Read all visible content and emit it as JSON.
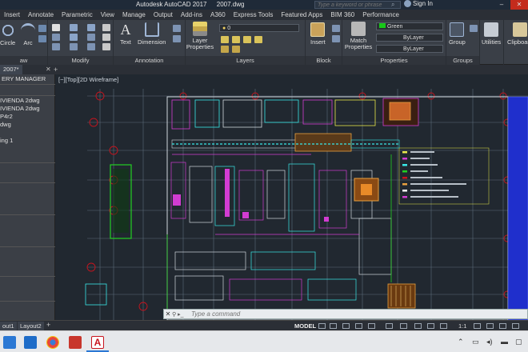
{
  "window": {
    "app_title": "Autodesk AutoCAD 2017",
    "file_name": "2007.dwg",
    "search_placeholder": "Type a keyword or phrase",
    "signin_label": "Sign In"
  },
  "menu_tabs": [
    "Insert",
    "Annotate",
    "Parametric",
    "View",
    "Manage",
    "Output",
    "Add-ins",
    "A360",
    "Express Tools",
    "Featured Apps",
    "BIM 360",
    "Performance"
  ],
  "ribbon": {
    "draw": {
      "circle": "Circle",
      "arc": "Arc",
      "label": "aw"
    },
    "modify": {
      "label": "Modify"
    },
    "annotation": {
      "text": "Text",
      "dimension": "Dimension",
      "label": "Annotation"
    },
    "layers": {
      "layer_properties": "Layer Properties",
      "layer_value": "0",
      "label": "Layers"
    },
    "block": {
      "insert": "Insert",
      "label": "Block"
    },
    "properties": {
      "match": "Match Properties",
      "color": "Green",
      "linetype": "ByLayer",
      "lineweight": "ByLayer",
      "label": "Properties"
    },
    "groups": {
      "group": "Group",
      "label": "Groups"
    },
    "utilities": {
      "label": "Utilities"
    },
    "clipboard": {
      "label": "Clipboard"
    }
  },
  "doc_tab": "2007*",
  "palette": {
    "title": "ERY MANAGER",
    "items": [
      "IVIENDA 2dwg",
      "IVIENDA 2dwg",
      "P4r2",
      "dwg",
      "",
      "ing 1"
    ]
  },
  "viewport_label": "[−][Top][2D Wireframe]",
  "command": {
    "placeholder": "Type a command"
  },
  "status": {
    "layout_tabs": [
      "out1",
      "Layout2"
    ],
    "model": "MODEL",
    "scale": "1:1"
  },
  "colors": {
    "ribbon_bg": "#3a3f47",
    "canvas_bg": "#212830",
    "grid_red": "#c8141e",
    "accent_blue": "#2134c8"
  }
}
